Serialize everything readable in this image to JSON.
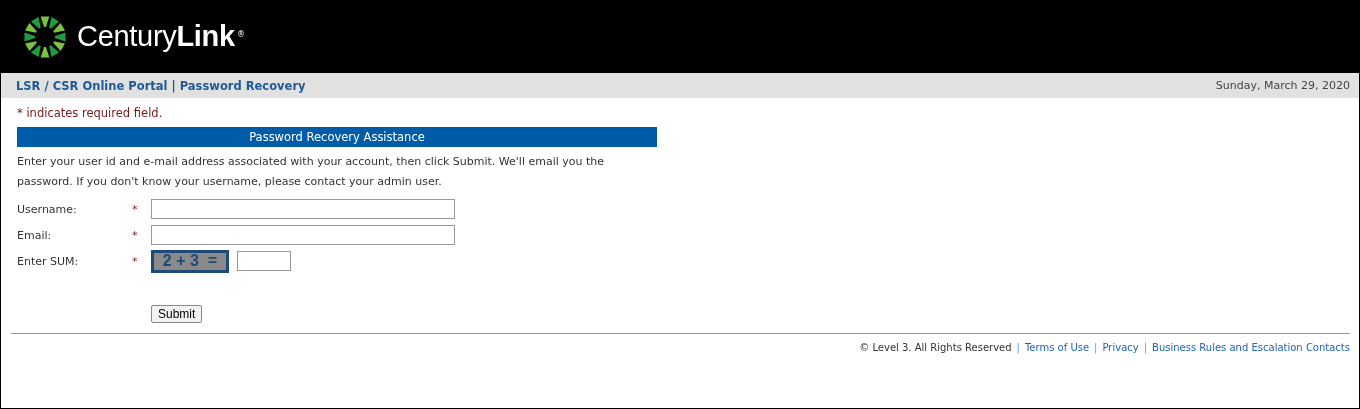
{
  "logo": {
    "name": "Century**Link**",
    "registered": "®"
  },
  "breadcrumb": "LSR / CSR Online Portal | Password Recovery",
  "date": "Sunday, March 29, 2020",
  "required_note": {
    "mark": "*",
    "text": "indicates required field."
  },
  "panel_title": "Password Recovery Assistance",
  "intro": "Enter your user id and e-mail address associated with your account, then click Submit. We'll email you the password. If you don't know your username, please contact your admin user.",
  "fields": [
    {
      "kind": "text",
      "label": "Username:",
      "required_mark": "*"
    },
    {
      "kind": "text",
      "label": "Email:",
      "required_mark": "*"
    },
    {
      "kind": "captcha",
      "label": "Enter SUM:",
      "required_mark": "*",
      "challenge": "2 + 3  ="
    }
  ],
  "submit": "Submit",
  "footer": {
    "copyright": "© Level 3. All Rights Reserved",
    "separator": "|",
    "links": [
      "Terms of Use",
      "Privacy",
      "Business Rules and Escalation Contacts"
    ]
  }
}
